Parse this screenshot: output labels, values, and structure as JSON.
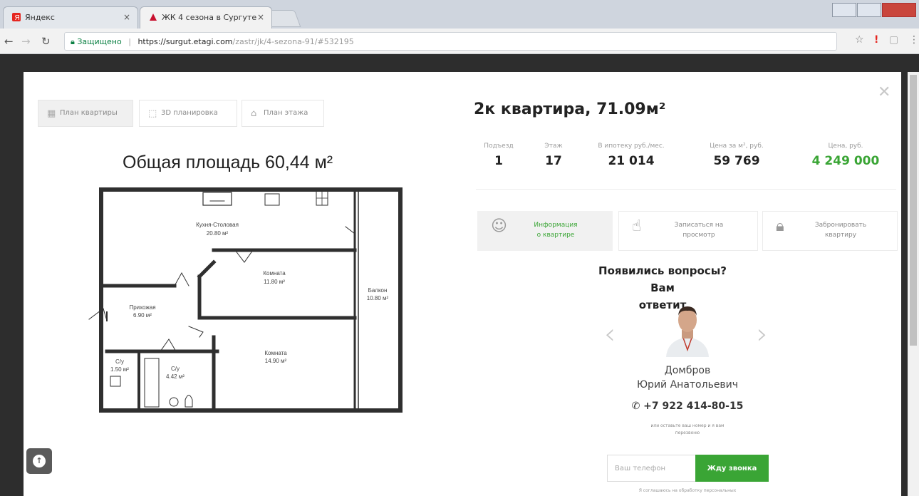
{
  "browser": {
    "tabs": [
      {
        "title": "Яндекс",
        "active": false
      },
      {
        "title": "ЖК 4 сезона в Сургуте",
        "active": true
      }
    ],
    "address": {
      "secure_label": "Защищено",
      "host": "https://surgut.etagi.com",
      "path": "/zastr/jk/4-sezona-91/#532195"
    }
  },
  "plan_tabs": [
    {
      "label": "План квартиры",
      "icon": "floorplan-icon",
      "active": true
    },
    {
      "label": "3D планировка",
      "icon": "3d-icon",
      "active": false
    },
    {
      "label": "План этажа",
      "icon": "floor-icon",
      "active": false
    }
  ],
  "plan": {
    "area_title": "Общая площадь 60,44 м²",
    "rooms": [
      {
        "name": "Кухня-Столовая",
        "area": "20.80 м²"
      },
      {
        "name": "Комната",
        "area": "11.80 м²"
      },
      {
        "name": "Балкон",
        "area": "10.80 м²"
      },
      {
        "name": "Прихожая",
        "area": "6.90 м²"
      },
      {
        "name": "Комната",
        "area": "14.90 м²"
      },
      {
        "name": "С/у",
        "area": "1.50 м²"
      },
      {
        "name": "С/у",
        "area": "4.42 м²"
      }
    ]
  },
  "flat": {
    "title": "2к квартира, 71.09м²",
    "stats": [
      {
        "label": "Подъезд",
        "value": "1"
      },
      {
        "label": "Этаж",
        "value": "17"
      },
      {
        "label": "В ипотеку руб./мес.",
        "value": "21 014"
      },
      {
        "label": "Цена за м², руб.",
        "value": "59 769"
      },
      {
        "label": "Цена, руб.",
        "value": "4 249 000"
      }
    ],
    "accent_color": "#3aa535"
  },
  "actions": [
    {
      "label_1": "Информация",
      "label_2": "о квартире",
      "active": true
    },
    {
      "label_1": "Записаться на",
      "label_2": "просмотр",
      "active": false
    },
    {
      "label_1": "Забронировать",
      "label_2": "квартиру",
      "active": false
    }
  ],
  "agent": {
    "question_line1": "Появились вопросы? Вам",
    "question_line2": "ответит",
    "surname": "Домбров",
    "given_names": "Юрий Анатольевич",
    "phone": "+7 922 414-80-15",
    "callback_line1": "или оставьте ваш номер и я вам",
    "callback_line2": "перезвоню",
    "phone_placeholder": "Ваш телефон",
    "submit_label": "Жду звонка",
    "consent": "Я соглашаюсь на обработку персональных"
  }
}
